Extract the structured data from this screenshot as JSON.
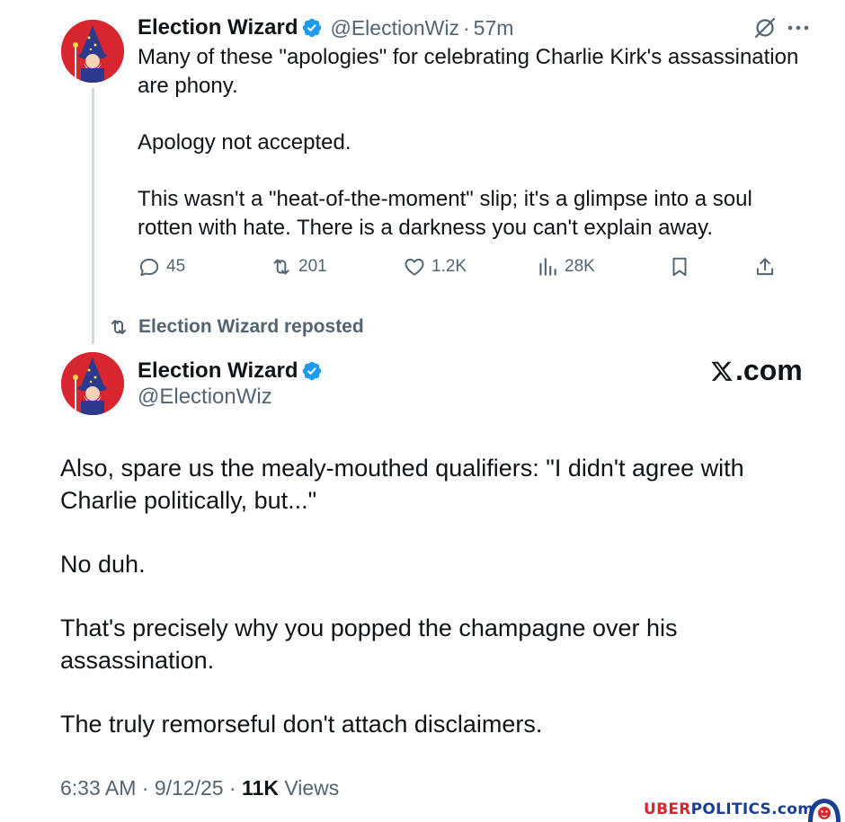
{
  "tweet1": {
    "author_name": "Election Wizard",
    "handle": "@ElectionWiz",
    "separator": "·",
    "time": "57m",
    "paragraphs": [
      "Many of these \"apologies\" for celebrating Charlie Kirk's assassination are phony.",
      "Apology not accepted.",
      "This wasn't a \"heat-of-the-moment\" slip; it's a glimpse into a soul rotten with hate. There is a darkness you can't explain away."
    ],
    "actions": {
      "replies": "45",
      "reposts": "201",
      "likes": "1.2K",
      "views": "28K"
    }
  },
  "repost_label": "Election Wizard reposted",
  "tweet2": {
    "author_name": "Election Wizard",
    "handle": "@ElectionWiz",
    "brand": ".com",
    "paragraphs": [
      "Also, spare us the mealy-mouthed qualifiers: \"I didn't agree with Charlie politically, but...\"",
      "No duh.",
      "That's precisely why you popped the champagne over his assassination.",
      "The truly remorseful don't attach disclaimers."
    ],
    "timestamp": "6:33 AM · 9/12/25 · ",
    "views_count": "11K",
    "views_label": " Views"
  },
  "watermark": {
    "part1": "UBER",
    "part2": "POLITICS.com"
  },
  "colors": {
    "verified": "#1d9bf0",
    "muted": "#536471",
    "avatar_bg": "#d7262f",
    "thread_line": "#cfd9de"
  },
  "icons": [
    "wizard-avatar",
    "verified-badge-icon",
    "grok-icon",
    "more-icon",
    "reply-icon",
    "repost-icon",
    "like-icon",
    "views-icon",
    "bookmark-icon",
    "share-icon",
    "x-logo-icon"
  ]
}
